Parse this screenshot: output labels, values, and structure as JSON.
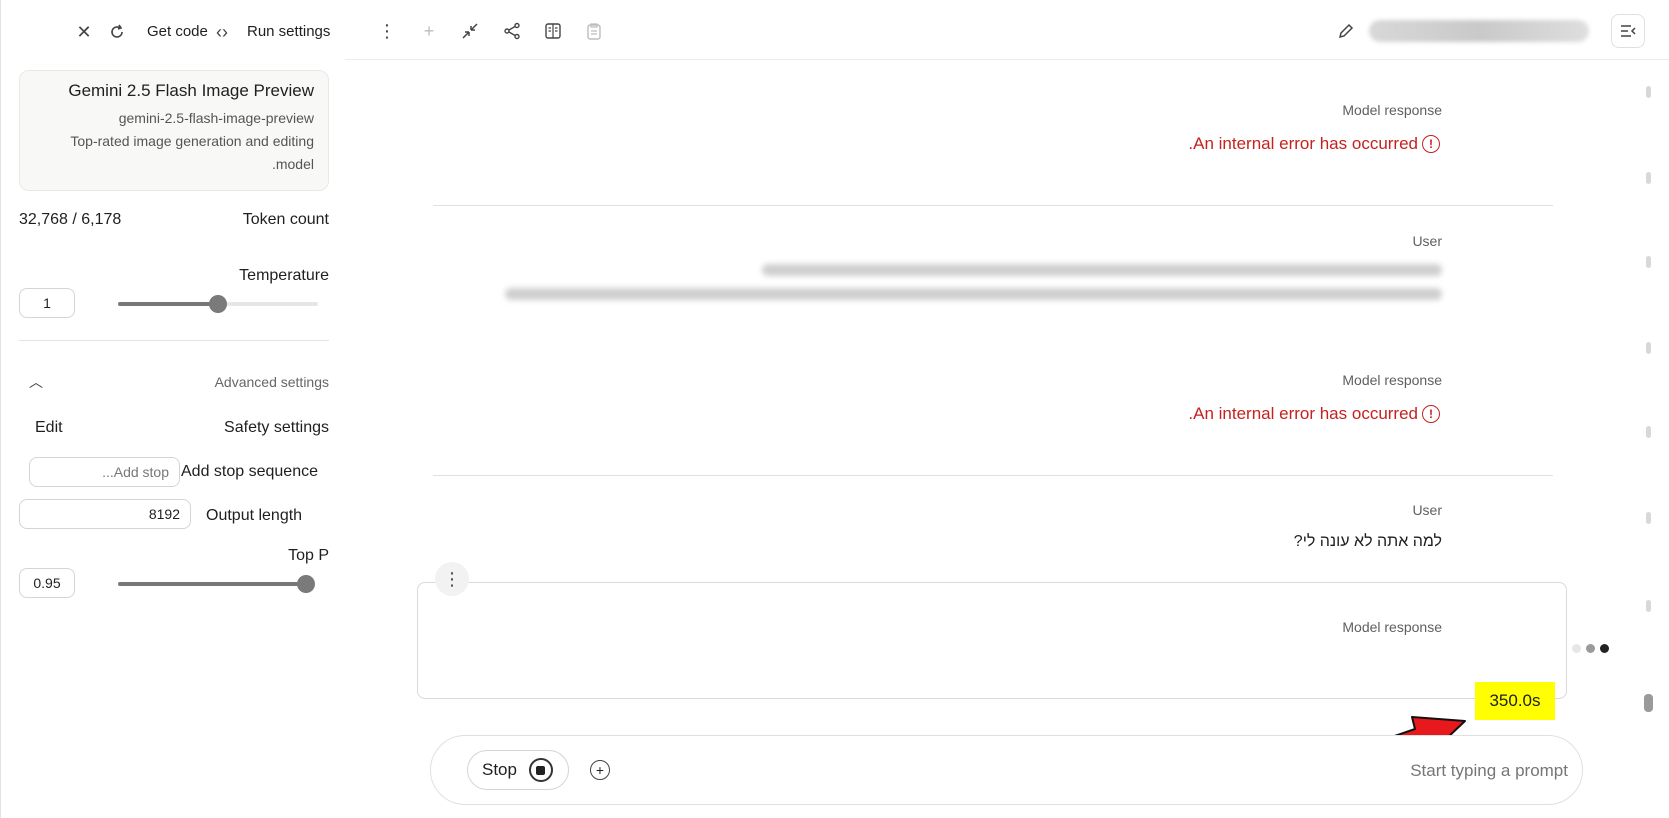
{
  "sidebar": {
    "get_code": "Get code",
    "run_settings": "Run settings",
    "model": {
      "name": "Gemini 2.5 Flash Image Preview",
      "id": "gemini-2.5-flash-image-preview",
      "description_line1": "Top-rated image generation and editing",
      "description_line2": ".model"
    },
    "token_count_label": "Token count",
    "token_count_value": "32,768 / 6,178",
    "temperature_label": "Temperature",
    "temperature_value": "1",
    "advanced_settings": "Advanced settings",
    "safety_settings": "Safety settings",
    "edit": "Edit",
    "stop_sequence_label": "Add stop sequence",
    "stop_sequence_placeholder": "...Add stop",
    "output_length_label": "Output length",
    "output_length_value": "8192",
    "top_p_label": "Top P",
    "top_p_value": "0.95"
  },
  "chat": {
    "messages": [
      {
        "role": "Model response",
        "error": ".An internal error has occurred"
      },
      {
        "role": "User",
        "text": ""
      },
      {
        "role": "Model response",
        "error": ".An internal error has occurred"
      },
      {
        "role": "User",
        "text": "למה אתה לא עונה לי?"
      },
      {
        "role": "Model response",
        "text": ""
      }
    ],
    "timer": "350.0s"
  },
  "prompt": {
    "stop_label": "Stop",
    "placeholder": "Start typing a prompt"
  },
  "colors": {
    "error": "#c5221f",
    "highlight": "#ffff00",
    "arrow": "#e8191d"
  },
  "icons": [
    "close-icon",
    "compare-icon",
    "code-icon",
    "more-vert-icon",
    "add-icon",
    "compress-icon",
    "share-icon",
    "compare-columns-icon",
    "clipboard-icon",
    "edit-pencil-icon",
    "panel-toggle-icon",
    "chevron-up-icon",
    "error-icon",
    "stop-icon",
    "add-circle-icon"
  ]
}
